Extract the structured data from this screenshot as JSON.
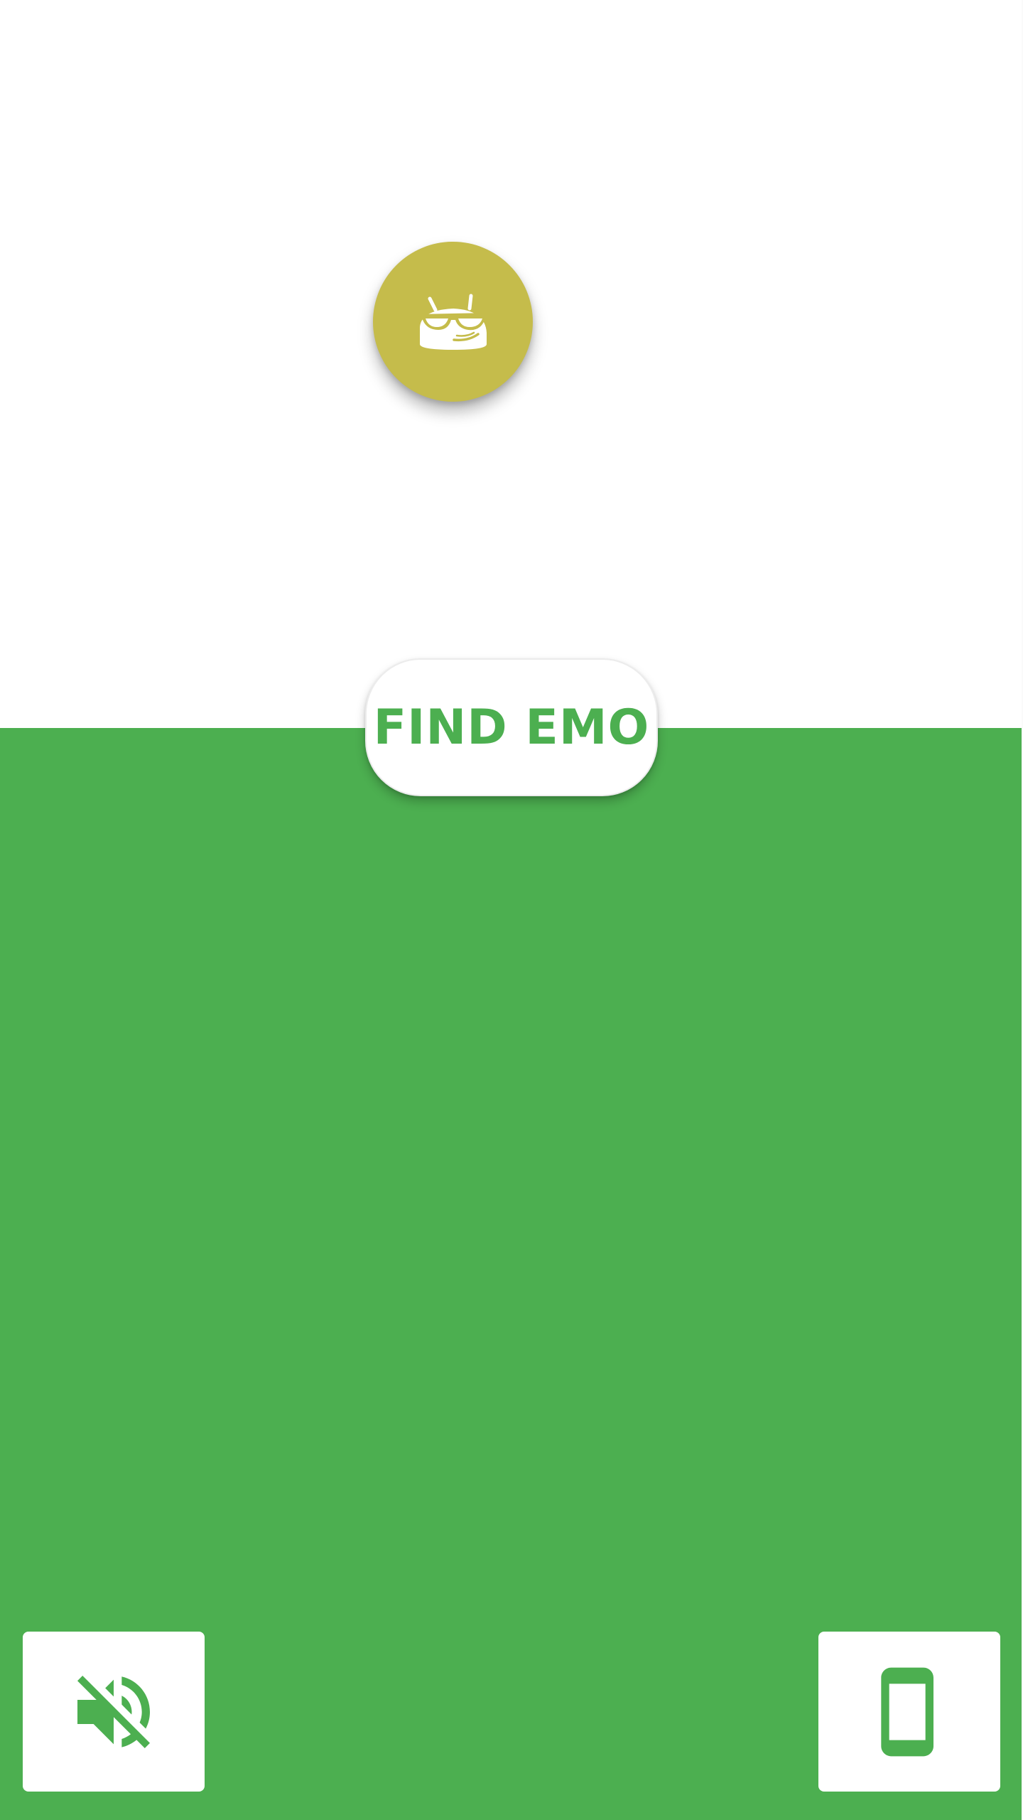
{
  "find_button": {
    "label": "FIND EMO"
  },
  "avatar": {
    "icon": "emo-robot-icon"
  },
  "controls": {
    "sound_icon": "volume-off-icon",
    "device_icon": "smartphone-icon"
  },
  "colors": {
    "primary_green": "#4caf50",
    "avatar_olive": "#c5bc4b",
    "surface": "#ffffff"
  }
}
